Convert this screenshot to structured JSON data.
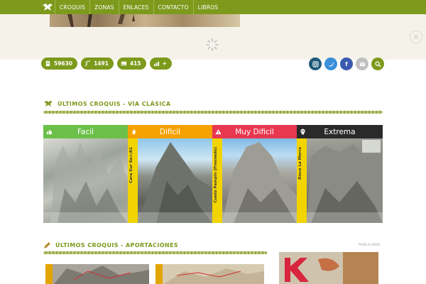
{
  "nav": {
    "items": [
      "CROQUIS",
      "ZONAS",
      "ENLACES",
      "CONTACTO",
      "LIBROS"
    ],
    "bg_color": "#7d9a1c"
  },
  "stats": [
    {
      "icon": "document-icon",
      "value": "59630"
    },
    {
      "icon": "route-icon",
      "value": "1491"
    },
    {
      "icon": "image-icon",
      "value": "415"
    },
    {
      "icon": "signal-icon",
      "value": "+"
    }
  ],
  "social": [
    {
      "icon": "instagram-icon",
      "color": "#1e5a78"
    },
    {
      "icon": "twitter-icon",
      "color": "#3b8fdb"
    },
    {
      "icon": "facebook-icon",
      "color": "#3b5bb0"
    },
    {
      "icon": "email-icon",
      "color": "#c0c0c0"
    },
    {
      "icon": "search-icon",
      "color": "#7d9a1c"
    }
  ],
  "sections": {
    "classic": "ÚLTIMOS CROQUIS - VÍA CLÁSICA",
    "contrib": "ÚLTIMOS CROQUIS - APORTACIONES"
  },
  "cards": [
    {
      "label": "Facil",
      "color": "#6cc04a",
      "icon": "thumbs-up-icon",
      "side_text": ""
    },
    {
      "label": "Dificil",
      "color": "#f5a100",
      "icon": "hand-icon",
      "side_text": "Cara Sur 6a+/A1"
    },
    {
      "label": "Muy Dificil",
      "color": "#e8384f",
      "icon": "warning-icon",
      "side_text": "Cueto Pampin (Fresnedo)"
    },
    {
      "label": "Extrema",
      "color": "#2a2a2a",
      "icon": "skull-icon",
      "side_text": "Risco La Morra"
    }
  ],
  "ad": {
    "label": "PUBLICIDAD"
  }
}
